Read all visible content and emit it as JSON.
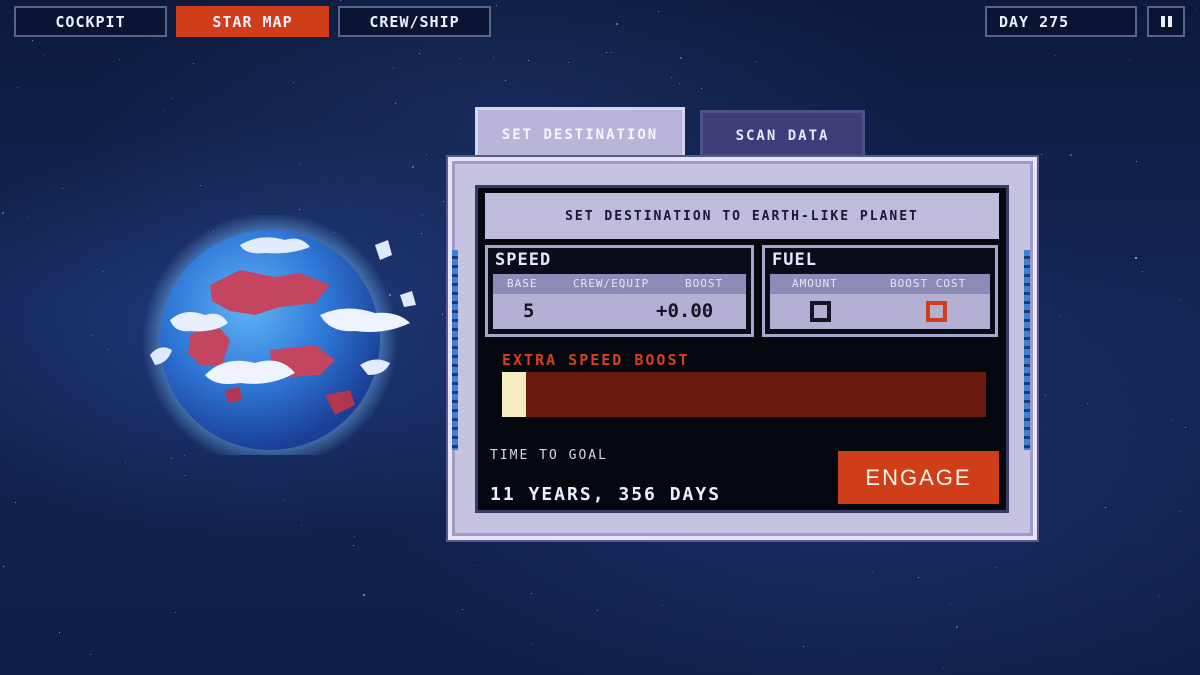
{
  "nav": {
    "cockpit": "COCKPIT",
    "star_map": "STAR MAP",
    "crew_ship": "CREW/SHIP",
    "active": "STAR MAP"
  },
  "status": {
    "day": "DAY 275",
    "pause_icon": "pause-icon"
  },
  "tabs": [
    {
      "label": "SET DESTINATION",
      "active": true
    },
    {
      "label": "SCAN DATA",
      "active": false
    }
  ],
  "panel": {
    "banner": "SET DESTINATION TO EARTH-LIKE PLANET",
    "speed": {
      "title": "SPEED",
      "columns": [
        "BASE",
        "CREW/EQUIP",
        "BOOST"
      ],
      "base": "5",
      "crew_equip": "",
      "boost": "+0.00"
    },
    "fuel": {
      "title": "FUEL",
      "columns": [
        "AMOUNT",
        "BOOST COST"
      ],
      "amount_icon": "empty-square-icon",
      "boost_cost_icon": "empty-square-red-icon"
    },
    "extra_boost": {
      "label": "EXTRA SPEED BOOST",
      "level": 0.05
    },
    "time_to_goal": {
      "label": "TIME TO GOAL",
      "value": "11 YEARS, 356 DAYS"
    },
    "engage_label": "ENGAGE"
  },
  "colors": {
    "accent": "#cf3e18",
    "panel": "#c6c3e2",
    "boost_track": "#6b1a12",
    "boost_fill": "#f6ebc1",
    "space_bg": "#132557"
  }
}
